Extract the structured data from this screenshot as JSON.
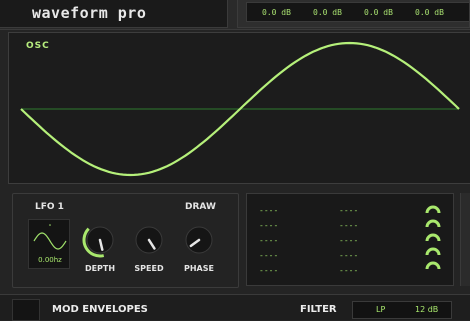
{
  "app": {
    "title": "waveform pro"
  },
  "meters": {
    "values": [
      "0.0 dB",
      "0.0 dB",
      "0.0 dB",
      "0.0 dB"
    ]
  },
  "osc": {
    "label": "OSC",
    "wave": "sine"
  },
  "lfo": {
    "title": "LFO 1",
    "draw_label": "DRAW",
    "rate": "0.00hz",
    "knobs": [
      {
        "label": "DEPTH",
        "value": 0.55
      },
      {
        "label": "SPEED",
        "value": 0.62
      },
      {
        "label": "PHASE",
        "value": 0.3
      }
    ]
  },
  "mod_readout": {
    "col1": [
      "----",
      "----",
      "----",
      "----",
      "----"
    ],
    "col2": [
      "----",
      "----",
      "----",
      "----",
      "----"
    ]
  },
  "bottom": {
    "mod_envelopes": "MOD ENVELOPES",
    "filter_label": "FILTER",
    "filter_type": "LP",
    "filter_slope": "12 dB"
  },
  "colors": {
    "accent": "#a9e86d",
    "background": "#242424"
  }
}
